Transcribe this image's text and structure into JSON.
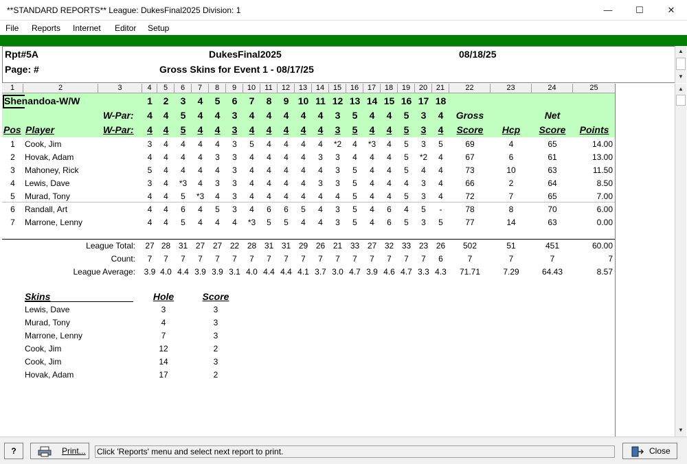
{
  "window": {
    "title": "**STANDARD REPORTS**    League: DukesFinal2025   Division: 1",
    "min": "—",
    "max": "☐",
    "close": "✕"
  },
  "menu": [
    "File",
    "Reports",
    "Internet",
    "Editor",
    "Setup"
  ],
  "report": {
    "rpt": "Rpt#5A",
    "page": "Page: #",
    "league": "DukesFinal2025",
    "date": "08/18/25",
    "subtitle": "Gross Skins for Event 1 - 08/17/25"
  },
  "columns": [
    "1",
    "2",
    "3",
    "4",
    "5",
    "6",
    "7",
    "8",
    "9",
    "10",
    "11",
    "12",
    "13",
    "14",
    "15",
    "16",
    "17",
    "18",
    "19",
    "20",
    "21",
    "22",
    "23",
    "24",
    "25"
  ],
  "course": "Shenandoa-W/W",
  "holes": [
    "1",
    "2",
    "3",
    "4",
    "5",
    "6",
    "7",
    "8",
    "9",
    "10",
    "11",
    "12",
    "13",
    "14",
    "15",
    "16",
    "17",
    "18"
  ],
  "wpar_label": "W-Par:",
  "wpar1": [
    "4",
    "4",
    "5",
    "4",
    "4",
    "3",
    "4",
    "4",
    "4",
    "4",
    "4",
    "3",
    "5",
    "4",
    "4",
    "5",
    "3",
    "4"
  ],
  "wpar2": [
    "4",
    "4",
    "5",
    "4",
    "4",
    "3",
    "4",
    "4",
    "4",
    "4",
    "4",
    "3",
    "5",
    "4",
    "4",
    "5",
    "3",
    "4"
  ],
  "headers": {
    "pos": "Pos",
    "player": "Player",
    "gross1": "Gross",
    "gross2": "Score",
    "hcp": "Hcp",
    "net1": "Net",
    "net2": "Score",
    "points": "Points"
  },
  "players": [
    {
      "pos": "1",
      "name": "Cook, Jim",
      "scores": [
        "3",
        "4",
        "4",
        "4",
        "4",
        "3",
        "5",
        "4",
        "4",
        "4",
        "4",
        "*2",
        "4",
        "*3",
        "4",
        "5",
        "3",
        "5"
      ],
      "gross": "69",
      "hcp": "4",
      "net": "65",
      "points": "14.00"
    },
    {
      "pos": "2",
      "name": "Hovak, Adam",
      "scores": [
        "4",
        "4",
        "4",
        "4",
        "3",
        "3",
        "4",
        "4",
        "4",
        "4",
        "3",
        "3",
        "4",
        "4",
        "4",
        "5",
        "*2",
        "4"
      ],
      "gross": "67",
      "hcp": "6",
      "net": "61",
      "points": "13.00"
    },
    {
      "pos": "3",
      "name": "Mahoney, Rick",
      "scores": [
        "5",
        "4",
        "4",
        "4",
        "4",
        "3",
        "4",
        "4",
        "4",
        "4",
        "4",
        "3",
        "5",
        "4",
        "4",
        "5",
        "4",
        "4"
      ],
      "gross": "73",
      "hcp": "10",
      "net": "63",
      "points": "11.50"
    },
    {
      "pos": "4",
      "name": "Lewis, Dave",
      "scores": [
        "3",
        "4",
        "*3",
        "4",
        "3",
        "3",
        "4",
        "4",
        "4",
        "4",
        "3",
        "3",
        "5",
        "4",
        "4",
        "4",
        "3",
        "4"
      ],
      "gross": "66",
      "hcp": "2",
      "net": "64",
      "points": "8.50"
    },
    {
      "pos": "5",
      "name": "Murad, Tony",
      "scores": [
        "4",
        "4",
        "5",
        "*3",
        "4",
        "3",
        "4",
        "4",
        "4",
        "4",
        "4",
        "4",
        "5",
        "4",
        "4",
        "5",
        "3",
        "4"
      ],
      "gross": "72",
      "hcp": "7",
      "net": "65",
      "points": "7.00"
    },
    {
      "pos": "6",
      "name": "Randall, Art",
      "scores": [
        "4",
        "4",
        "6",
        "4",
        "5",
        "3",
        "4",
        "6",
        "6",
        "5",
        "4",
        "3",
        "5",
        "4",
        "6",
        "4",
        "5",
        "-"
      ],
      "gross": "78",
      "hcp": "8",
      "net": "70",
      "points": "6.00"
    },
    {
      "pos": "7",
      "name": "Marrone, Lenny",
      "scores": [
        "4",
        "4",
        "5",
        "4",
        "4",
        "4",
        "*3",
        "5",
        "5",
        "4",
        "4",
        "3",
        "5",
        "4",
        "6",
        "5",
        "3",
        "5"
      ],
      "gross": "77",
      "hcp": "14",
      "net": "63",
      "points": "0.00"
    }
  ],
  "summary": [
    {
      "label": "League Total:",
      "holes": [
        "27",
        "28",
        "31",
        "27",
        "27",
        "22",
        "28",
        "31",
        "31",
        "29",
        "26",
        "21",
        "33",
        "27",
        "32",
        "33",
        "23",
        "26"
      ],
      "gross": "502",
      "hcp": "51",
      "net": "451",
      "points": "60.00"
    },
    {
      "label": "Count:",
      "holes": [
        "7",
        "7",
        "7",
        "7",
        "7",
        "7",
        "7",
        "7",
        "7",
        "7",
        "7",
        "7",
        "7",
        "7",
        "7",
        "7",
        "7",
        "6"
      ],
      "gross": "7",
      "hcp": "7",
      "net": "7",
      "points": "7"
    },
    {
      "label": "League Average:",
      "holes": [
        "3.9",
        "4.0",
        "4.4",
        "3.9",
        "3.9",
        "3.1",
        "4.0",
        "4.4",
        "4.4",
        "4.1",
        "3.7",
        "3.0",
        "4.7",
        "3.9",
        "4.6",
        "4.7",
        "3.3",
        "4.3"
      ],
      "gross": "71.71",
      "hcp": "7.29",
      "net": "64.43",
      "points": "8.57"
    }
  ],
  "skins": {
    "headers": {
      "skins": "Skins",
      "hole": "Hole",
      "score": "Score"
    },
    "rows": [
      {
        "name": "Lewis, Dave",
        "hole": "3",
        "score": "3"
      },
      {
        "name": "Murad, Tony",
        "hole": "4",
        "score": "3"
      },
      {
        "name": "Marrone, Lenny",
        "hole": "7",
        "score": "3"
      },
      {
        "name": "Cook, Jim",
        "hole": "12",
        "score": "2"
      },
      {
        "name": "Cook, Jim",
        "hole": "14",
        "score": "3"
      },
      {
        "name": "Hovak, Adam",
        "hole": "17",
        "score": "2"
      }
    ]
  },
  "status": {
    "help_icon": "?",
    "print": "Print...",
    "message": "Click 'Reports' menu and select next report to print.",
    "close": "Close"
  }
}
